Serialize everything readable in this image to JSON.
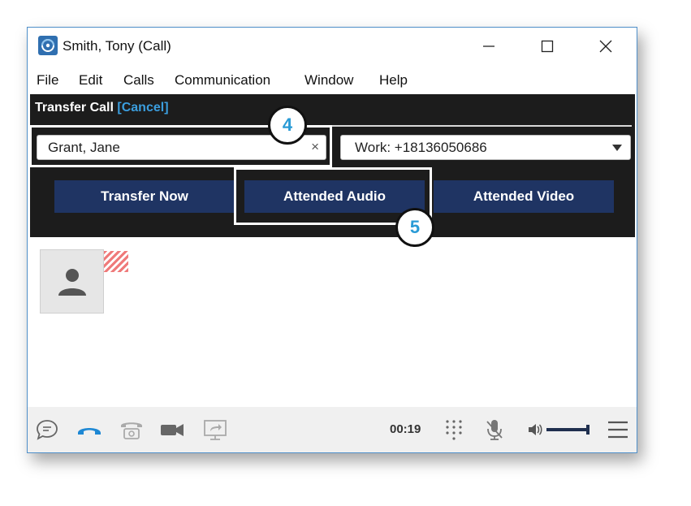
{
  "window": {
    "title": "Smith, Tony (Call)"
  },
  "menu": {
    "items": [
      "File",
      "Edit",
      "Calls",
      "Communication",
      "Window",
      "Help"
    ]
  },
  "transfer": {
    "title": "Transfer Call",
    "cancel_label": "[Cancel]",
    "name_value": "Grant, Jane",
    "clear_symbol": "×",
    "number_value": "Work: +18136050686",
    "buttons": {
      "transfer_now": "Transfer Now",
      "attended_audio": "Attended Audio",
      "attended_video": "Attended Video"
    }
  },
  "callouts": {
    "step4": "4",
    "step5": "5"
  },
  "controls": {
    "timer": "00:19",
    "icons": [
      "chat-icon",
      "hangup-icon",
      "phone-icon",
      "video-icon",
      "screen-share-icon",
      "dialpad-icon",
      "mute-icon",
      "volume-icon",
      "menu-icon"
    ]
  },
  "colors": {
    "panel_bg": "#1c1c1c",
    "button_bg": "#1f3463",
    "cancel_link": "#3b9ede",
    "hangup_accent": "#1e88d4",
    "callout_text": "#2a9bd6",
    "window_border": "#4f8fc9"
  }
}
